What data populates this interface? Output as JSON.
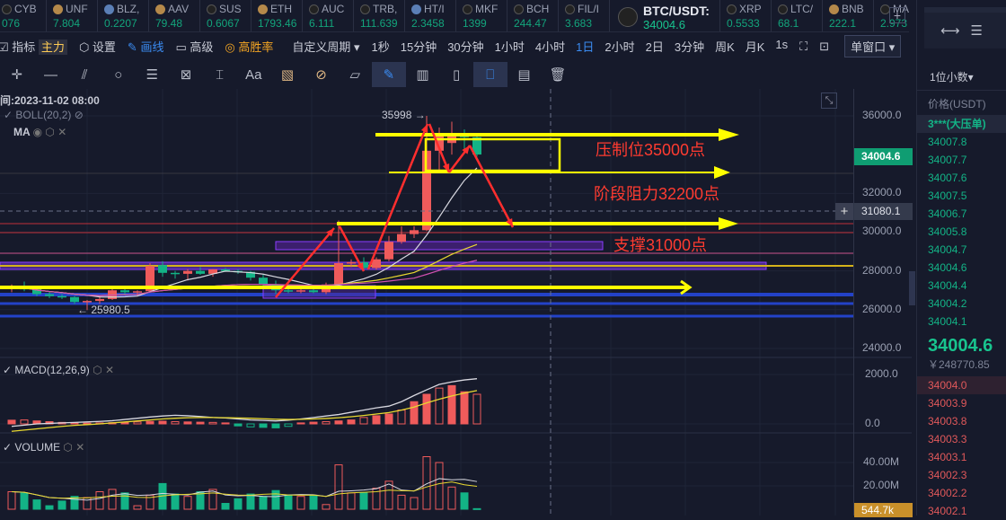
{
  "ticker": [
    {
      "name": "CYB",
      "value": "076",
      "coin": "x"
    },
    {
      "name": "UNF",
      "value": "7.804",
      "coin": "b"
    },
    {
      "name": "BLZ,",
      "value": "0.2207",
      "coin": "d"
    },
    {
      "name": "AAV",
      "value": "79.48",
      "coin": "b"
    },
    {
      "name": "SUS",
      "value": "0.6067",
      "coin": "x"
    },
    {
      "name": "ETH",
      "value": "1793.46",
      "coin": "b"
    },
    {
      "name": "AUC",
      "value": "6.111",
      "coin": "x"
    },
    {
      "name": "TRB,",
      "value": "111.639",
      "coin": "x"
    },
    {
      "name": "HT/I",
      "value": "2.3458",
      "coin": "d"
    },
    {
      "name": "MKF",
      "value": "1399",
      "coin": "x"
    },
    {
      "name": "BCH",
      "value": "244.47",
      "coin": "x"
    },
    {
      "name": "FIL/I",
      "value": "3.683",
      "coin": "x"
    }
  ],
  "ticker_main": {
    "name": "BTC/USDT:",
    "value": "34004.6"
  },
  "ticker2": [
    {
      "name": "XRP",
      "value": "0.5533",
      "coin": "x"
    },
    {
      "name": "LTC/",
      "value": "68.1",
      "coin": "x"
    },
    {
      "name": "BNB",
      "value": "222.1",
      "coin": "b"
    },
    {
      "name": "MAS",
      "value": "2.973",
      "coin": "x"
    }
  ],
  "toolbar": {
    "indicator": "指标",
    "main": "主力",
    "settings": "设置",
    "draw": "画线",
    "advanced": "高级",
    "winrate": "高胜率",
    "custom": "自定义周期 ▾",
    "timeframes": [
      "1秒",
      "15分钟",
      "30分钟",
      "1小时",
      "4小时",
      "1日",
      "2小时",
      "2日",
      "3分钟",
      "周K",
      "月K",
      "1s"
    ],
    "active": "1日",
    "window": "单窗口 ▾"
  },
  "drawtools": [
    "crosshair",
    "line",
    "parallel",
    "circle",
    "fib",
    "pattern",
    "measure",
    "Aa",
    "ruler-orange",
    "magnet",
    "ruler",
    "brush",
    "candles",
    "lock",
    "bookmark",
    "note",
    "trash"
  ],
  "chart": {
    "time_label": "间:2023-11-02 08:00",
    "boll": "BOLL(20,2)",
    "ma": "MA",
    "macd": "MACD(12,26,9)",
    "volume": "VOLUME",
    "high_label": "35998 →",
    "low_label": "← 25980.5",
    "annotations": {
      "resist": "压制位35000点",
      "stage": "阶段阻力32200点",
      "support": "支撑31000点"
    },
    "price_ticks": [
      "36000.0",
      "32000.0",
      "30000.0",
      "28000.0",
      "26000.0",
      "24000.0"
    ],
    "price_tag": "34004.6",
    "cross_tag": "31080.1",
    "macd_ticks": [
      "2000.0",
      "0.0"
    ],
    "vol_ticks": [
      "40.00M",
      "20.00M"
    ],
    "vol_tag": "544.7k"
  },
  "chart_data": {
    "type": "candlestick",
    "ohlc": [
      [
        27100,
        27300,
        26900,
        27200
      ],
      [
        27200,
        27450,
        26950,
        27050
      ],
      [
        27050,
        27200,
        26700,
        26800
      ],
      [
        26800,
        26900,
        26600,
        26700
      ],
      [
        26700,
        26800,
        26550,
        26650
      ],
      [
        26650,
        26700,
        26300,
        26400
      ],
      [
        26400,
        26500,
        25980.5,
        26450
      ],
      [
        26450,
        26700,
        26300,
        26550
      ],
      [
        26550,
        27100,
        26500,
        27000
      ],
      [
        27000,
        27200,
        26800,
        26900
      ],
      [
        26900,
        27000,
        26700,
        26950
      ],
      [
        26950,
        28400,
        26900,
        28250
      ],
      [
        28300,
        28500,
        27700,
        27900
      ],
      [
        27900,
        28000,
        27600,
        27850
      ],
      [
        27850,
        28100,
        27500,
        28000
      ],
      [
        28000,
        28200,
        27800,
        27850
      ],
      [
        27850,
        28100,
        27700,
        28080
      ],
      [
        28080,
        28150,
        27950,
        28000
      ],
      [
        28000,
        28100,
        27850,
        27950
      ],
      [
        27950,
        28000,
        27500,
        27650
      ],
      [
        27650,
        27800,
        27100,
        27300
      ],
      [
        27300,
        27500,
        26800,
        27000
      ],
      [
        27000,
        27150,
        26850,
        26950
      ],
      [
        26950,
        27100,
        26850,
        27000
      ],
      [
        27000,
        27100,
        26850,
        26900
      ],
      [
        26900,
        27400,
        26800,
        27300
      ],
      [
        27300,
        30600,
        27200,
        28400
      ],
      [
        28400,
        28600,
        28200,
        28450
      ],
      [
        28450,
        28700,
        28000,
        28150
      ],
      [
        28150,
        28700,
        28050,
        28600
      ],
      [
        28600,
        29800,
        28500,
        29500
      ],
      [
        29500,
        30300,
        29400,
        29900
      ],
      [
        29900,
        30300,
        29700,
        30100
      ],
      [
        30100,
        35998,
        30050,
        34200
      ],
      [
        34200,
        35400,
        33200,
        35000
      ],
      [
        34600,
        35700,
        34000,
        35100
      ],
      [
        35100,
        35300,
        34100,
        34900
      ],
      [
        34900,
        35100,
        33900,
        34004.6
      ]
    ],
    "volume_m": [
      15,
      14,
      8,
      3,
      7,
      11,
      10,
      15,
      17,
      14,
      3,
      12,
      22,
      13,
      11,
      15,
      17,
      5,
      9,
      13,
      11,
      16,
      12,
      11,
      12,
      4,
      38,
      14,
      14,
      18,
      24,
      12,
      10,
      45,
      40,
      19,
      14,
      0.5
    ],
    "macd_hist": [
      150,
      160,
      120,
      90,
      60,
      40,
      30,
      40,
      50,
      60,
      80,
      100,
      110,
      90,
      80,
      70,
      60,
      40,
      -80,
      -120,
      -140,
      -160,
      -100,
      40,
      70,
      90,
      120,
      160,
      260,
      330,
      400,
      560,
      900,
      1200,
      1450,
      1550,
      1300,
      1200
    ],
    "macd_dif": [
      -100,
      -50,
      0,
      20,
      40,
      60,
      80,
      100,
      130,
      180,
      230,
      280,
      320,
      350,
      330,
      300,
      260,
      240,
      200,
      160,
      140,
      120,
      150,
      200,
      260,
      320,
      380,
      470,
      560,
      650,
      720,
      900,
      1150,
      1380,
      1600,
      1700,
      1780,
      1830
    ],
    "macd_dea": [
      -300,
      -250,
      -200,
      -150,
      -100,
      -60,
      -30,
      0,
      40,
      80,
      120,
      160,
      200,
      230,
      250,
      260,
      260,
      250,
      240,
      230,
      210,
      190,
      180,
      185,
      200,
      220,
      250,
      290,
      340,
      400,
      460,
      560,
      680,
      850,
      1000,
      1130,
      1250,
      1350
    ],
    "ylim": [
      24000,
      36500
    ]
  },
  "orderbook": {
    "decimals": "1位小数▾",
    "header": "价格(USDT)",
    "big": "3***(大压单)",
    "asks": [
      "34007.8",
      "34007.7",
      "34007.6",
      "34007.5",
      "34006.7",
      "34005.8",
      "34004.7",
      "34004.6",
      "34004.4",
      "34004.2",
      "34004.1"
    ],
    "last": "34004.6",
    "cny": "￥248770.85",
    "bids": [
      "34004.0",
      "34003.9",
      "34003.8",
      "34003.3",
      "34003.1",
      "34002.3",
      "34002.2",
      "34002.1"
    ]
  }
}
